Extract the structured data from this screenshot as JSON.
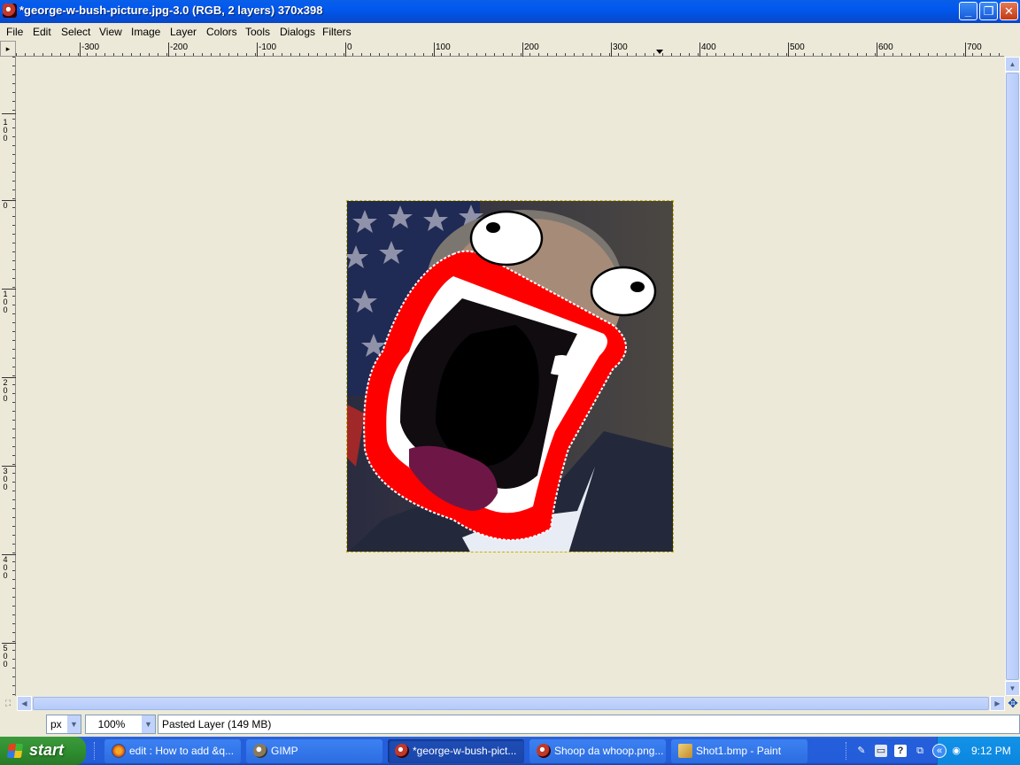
{
  "window": {
    "title": "*george-w-bush-picture.jpg-3.0 (RGB, 2 layers) 370x398",
    "icon": "gimp-image-icon",
    "minimize": "_",
    "maximize": "❐",
    "close": "✕"
  },
  "menu": [
    "File",
    "Edit",
    "Select",
    "View",
    "Image",
    "Layer",
    "Colors",
    "Tools",
    "Dialogs",
    "Filters"
  ],
  "ruler": {
    "corner": "▸",
    "h_labels": [
      "-300",
      "-200",
      "-100",
      "0",
      "100",
      "200",
      "300",
      "400",
      "500",
      "600",
      "700"
    ],
    "v_labels": [
      "100",
      "0",
      "100",
      "200",
      "300",
      "400",
      "500"
    ]
  },
  "status": {
    "unit": "px",
    "zoom": "100%",
    "message": "Pasted Layer (149 MB)"
  },
  "scroll": {
    "up": "▲",
    "down": "▼",
    "left": "◀",
    "right": "▶",
    "quick_mask": "⛶",
    "navigate": "✥"
  },
  "taskbar": {
    "start": "start",
    "buttons": [
      {
        "label": "edit : How to add &q...",
        "icon": "firefox-icon",
        "active": false
      },
      {
        "label": "GIMP",
        "icon": "gimp-icon",
        "active": false
      },
      {
        "label": "*george-w-bush-pict...",
        "icon": "gimp-image-icon",
        "active": true
      },
      {
        "label": "Shoop da whoop.png...",
        "icon": "gimp-image-icon",
        "active": false
      },
      {
        "label": "Shot1.bmp - Paint",
        "icon": "paint-icon",
        "active": false
      }
    ],
    "clock": "9:12 PM",
    "tray_arrow": "«"
  }
}
